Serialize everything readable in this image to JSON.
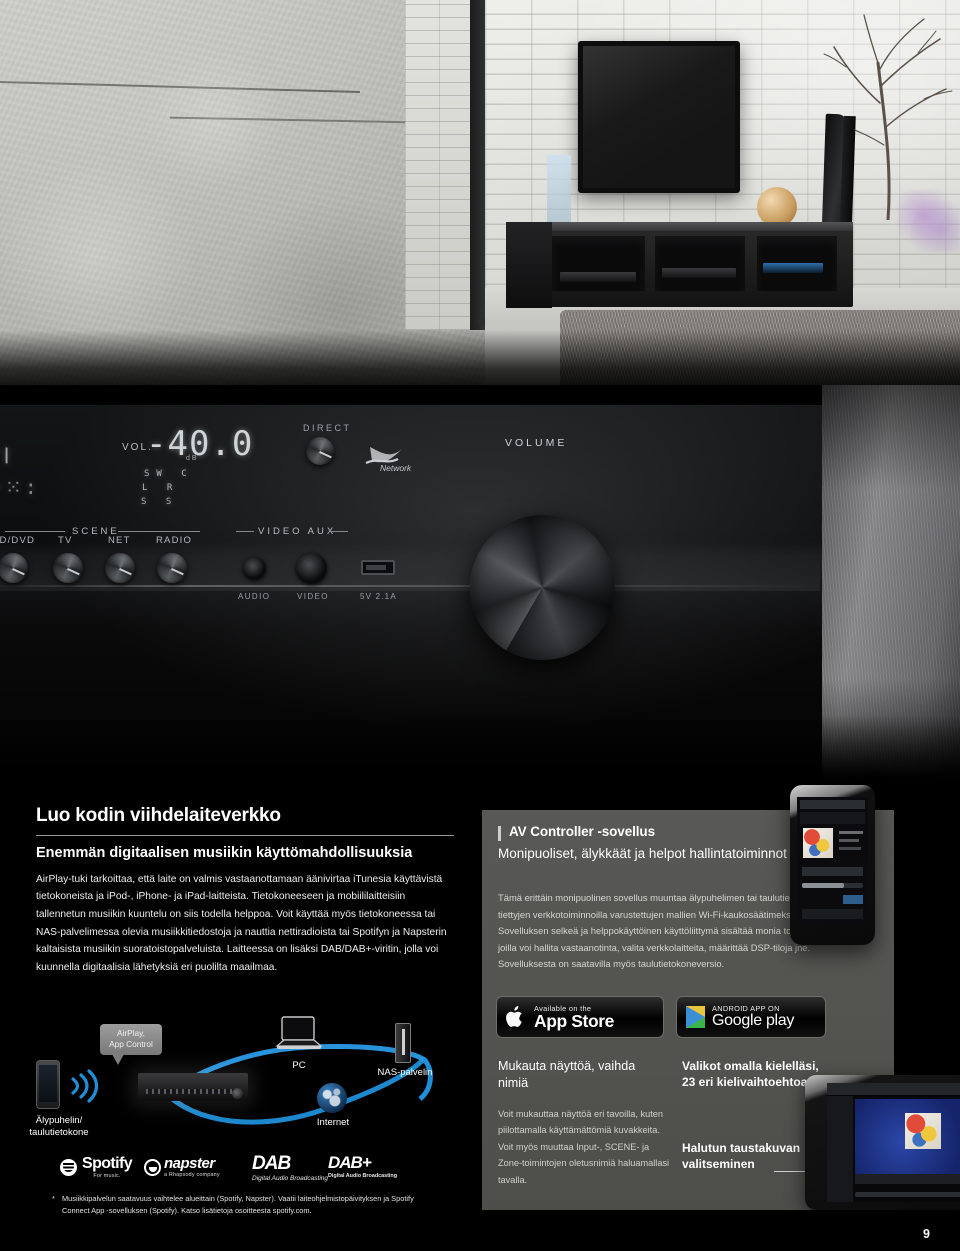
{
  "hero": {
    "alt": "Living room with wall-mounted flat TV, black media cabinet, tower speakers, brick wall and shag rug"
  },
  "receiver": {
    "alt": "Close-up of black AV receiver front panel",
    "display": {
      "vol_label": "VOL.",
      "vol_value": "-40.0",
      "vol_unit": "dB",
      "indicators": [
        "SW",
        "C",
        "L",
        "R",
        "LS",
        "RS"
      ]
    },
    "direct_label": "DIRECT",
    "network_logo_text": "Network",
    "scene_label": "SCENE",
    "scene_buttons": [
      "BD/DVD",
      "TV",
      "NET",
      "RADIO"
    ],
    "video_aux_label": "VIDEO AUX",
    "aux_ports": [
      "AUDIO",
      "VIDEO",
      "5V 2.1A"
    ],
    "volume_label": "VOLUME"
  },
  "left": {
    "title": "Luo kodin viihdelaiteverkko",
    "subtitle": "Enemmän digitaalisen musiikin käyttömahdollisuuksia",
    "body": "AirPlay-tuki tarkoittaa, että laite on valmis vastaanottamaan äänivirtaa iTunesia käyttävistä tietokoneista ja iPod-, iPhone- ja iPad-laitteista. Tietokoneeseen ja mobiililaitteisiin tallennetun musiikin kuuntelu on siis todella helppoa. Voit käyttää myös tietokoneessa tai NAS-palvelimessa olevia musiikkitiedostoja ja nauttia nettiradioista tai Spotifyn ja Napsterin kaltaisista musiikin suoratoistopalveluista. Laitteessa on lisäksi DAB/DAB+-viritin, jolla voi kuunnella digitaalisia lähetyksiä eri puolilta maailmaa.",
    "diagram": {
      "callout": "AirPlay,\nApp Control",
      "callout_line1": "AirPlay,",
      "callout_line2": "App Control",
      "phone_label_line1": "Älypuhelin/",
      "phone_label_line2": "taulutietokone",
      "pc_label": "PC",
      "nas_label": "NAS-palvelin",
      "internet_label": "Internet"
    },
    "logos": [
      {
        "name": "Spotify",
        "tagline": "For music."
      },
      {
        "name": "napster",
        "tagline": "a Rhapsody company"
      },
      {
        "name": "DAB",
        "tagline": "Digital Audio Broadcasting"
      },
      {
        "name": "DAB+",
        "tagline": "Digital Audio Broadcasting"
      }
    ],
    "footnote_marker": "*",
    "footnote": "Musiikkipalvelun saatavuus vaihtelee alueittain (Spotify, Napster). Vaatii laiteohjelmistopäivityksen ja Spotify Connect App -sovelluksen (Spotify). Katso lisätietoja osoitteesta spotify.com."
  },
  "right": {
    "title": "AV Controller -sovellus",
    "subtitle": "Monipuoliset, älykkäät ja helpot hallintatoiminnot",
    "body": "Tämä erittäin monipuolinen sovellus muuntaa älypuhelimen tai taulutietokoneen tiettyjen verkkotoiminnoilla varustettujen mallien Wi-Fi-kaukosäätimeksi. Sovelluksen selkeä ja helppokäyttöinen käyttöliittymä sisältää monia toimintoja, joilla voi hallita vastaanotinta, valita verkkolaitteita, määrittää DSP-tiloja jne. Sovelluksesta on saatavilla myös taulutietokoneversio.",
    "badges": [
      {
        "line1": "Available on the",
        "line2": "App Store",
        "icon": "apple-icon"
      },
      {
        "line1": "ANDROID APP ON",
        "line2": "Google play",
        "icon": "google-play-icon"
      }
    ],
    "feature_left": {
      "heading": "Mukauta näyttöä, vaihda nimiä",
      "body": "Voit mukauttaa näyttöä eri tavoilla, kuten piilottamalla käyttämättömiä kuvakkeita. Voit myös muuttaa Input-, SCENE- ja Zone-toimintojen oletusnimiä haluamallasi tavalla."
    },
    "callouts": [
      {
        "text_line1": "Valikot omalla kielelläsi,",
        "text_line2": "23 eri kielivaihtoehtoa"
      },
      {
        "text_line1": "Halutun taustakuvan",
        "text_line2": "valitseminen"
      }
    ]
  },
  "page_number": "9",
  "colors": {
    "panel_gray": "#53534f",
    "accent_white": "#cfcfcf",
    "network_blue": "#1f8fd8",
    "page_bg": "#000000"
  }
}
